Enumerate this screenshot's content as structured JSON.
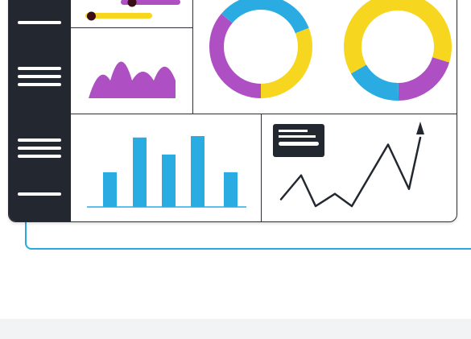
{
  "colors": {
    "purple": "#ae4fc4",
    "yellow": "#f7d61f",
    "blue": "#2aace2",
    "dark": "#232830",
    "outline": "#2aa9dc"
  },
  "sidebar": {
    "icons": [
      "menu-line-icon",
      "menu-lines-icon",
      "menu-lines-icon",
      "menu-line-icon"
    ]
  },
  "widgets": {
    "slider_panel": {
      "sliders": [
        0.09,
        0.4
      ]
    },
    "area_chart": {
      "peaks": [
        0.55,
        0.95,
        0.55,
        0.75
      ]
    },
    "donut_left": {
      "segments": [
        {
          "color": "purple",
          "value": 0.36
        },
        {
          "color": "blue",
          "value": 0.33
        },
        {
          "color": "yellow",
          "value": 0.31
        }
      ]
    },
    "donut_right": {
      "segments": [
        {
          "color": "yellow",
          "value": 0.63
        },
        {
          "color": "purple",
          "value": 0.2
        },
        {
          "color": "blue",
          "value": 0.17
        }
      ]
    },
    "bar_chart": {
      "values": [
        0.49,
        0.98,
        0.74,
        1.0,
        0.49
      ]
    },
    "line_chart": {
      "values": [
        0.1,
        0.45,
        0.0,
        0.18,
        0.0,
        0.9,
        0.25,
        1.0
      ]
    }
  }
}
